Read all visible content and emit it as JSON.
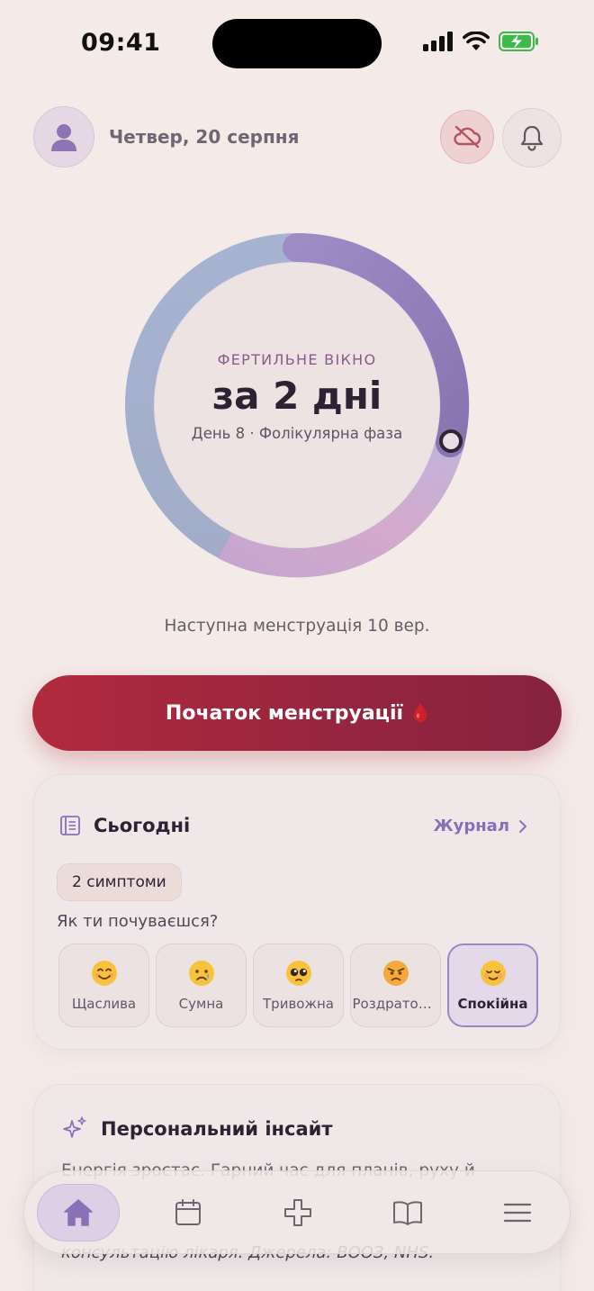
{
  "status_bar": {
    "time": "09:41"
  },
  "header": {
    "date": "Четвер, 20 серпня"
  },
  "cycle": {
    "label": "ФЕРТИЛЬНЕ ВІКНО",
    "value": "за 2 дні",
    "subtitle": "День 8 · Фолікулярна фаза",
    "next_period": "Наступна менструація 10 вер."
  },
  "cta": {
    "label": "Початок менструації",
    "icon": "blood-drop-icon"
  },
  "today": {
    "title": "Сьогодні",
    "journal_link": "Журнал",
    "symptoms_chip": "2 симптоми",
    "question": "Як ти почуваєшся?",
    "moods": [
      {
        "emoji": "smiling-face-icon",
        "label": "Щаслива",
        "selected": false
      },
      {
        "emoji": "crying-face-icon",
        "label": "Сумна",
        "selected": false
      },
      {
        "emoji": "pleading-face-icon",
        "label": "Тривожна",
        "selected": false
      },
      {
        "emoji": "angry-face-icon",
        "label": "Роздратов...",
        "selected": false
      },
      {
        "emoji": "relieved-face-icon",
        "label": "Спокійна",
        "selected": true
      }
    ]
  },
  "insight": {
    "title": "Персональний інсайт",
    "body": "Енергія зростає. Гарний час для планів, руху й",
    "source": "консультацію лікаря. Джерела: ВООЗ, NHS."
  },
  "nav": {
    "items": [
      {
        "icon": "home-icon",
        "active": true
      },
      {
        "icon": "calendar-icon",
        "active": false
      },
      {
        "icon": "health-plus-icon",
        "active": false
      },
      {
        "icon": "book-icon",
        "active": false
      },
      {
        "icon": "menu-icon",
        "active": false
      }
    ]
  },
  "colors": {
    "accent": "#8a6fb8",
    "cta": "#a5283f",
    "background": "#f4ebe8"
  }
}
